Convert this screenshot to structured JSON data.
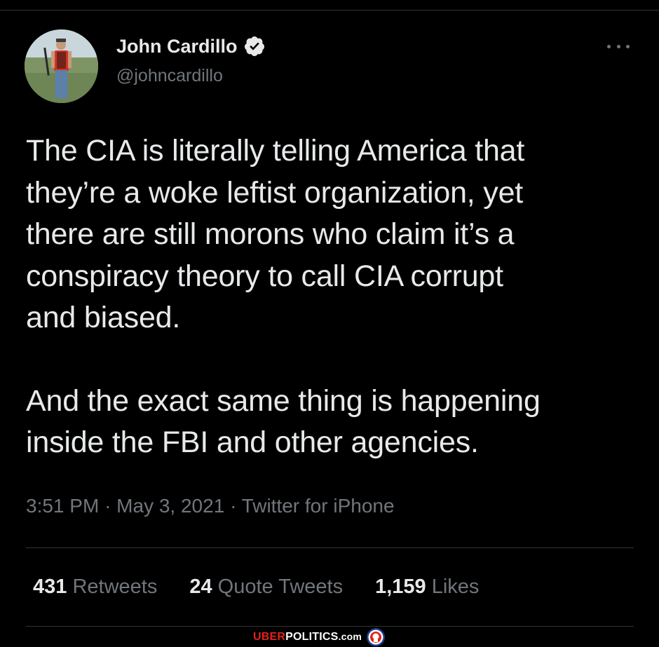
{
  "tweet": {
    "author": {
      "display_name": "John Cardillo",
      "handle": "@johncardillo",
      "verified": true,
      "avatar_icon": "profile-photo"
    },
    "more_icon": "more-horizontal-icon",
    "text_paragraphs": [
      "The CIA is literally telling America that\nthey’re a woke leftist organization, yet\nthere are still morons who claim it’s a\nconspiracy theory to call CIA corrupt\nand biased.",
      "And the exact same thing is happening\ninside the FBI and other agencies."
    ],
    "meta": {
      "time": "3:51 PM",
      "date": "May 3, 2021",
      "client": "Twitter for iPhone",
      "separator": "·"
    },
    "stats": {
      "retweets_count": "431",
      "retweets_label": "Retweets",
      "quotes_count": "24",
      "quotes_label": "Quote Tweets",
      "likes_count": "1,159",
      "likes_label": "Likes"
    }
  },
  "watermark": {
    "part_a": "UBER",
    "part_b": "POLITICS",
    "part_c": ".com"
  },
  "colors": {
    "background": "#000000",
    "text_primary": "#e7e9ea",
    "text_secondary": "#71767b",
    "divider": "#2f3336",
    "verified_badge": "#e7e9ea",
    "watermark_red": "#e2231a"
  }
}
